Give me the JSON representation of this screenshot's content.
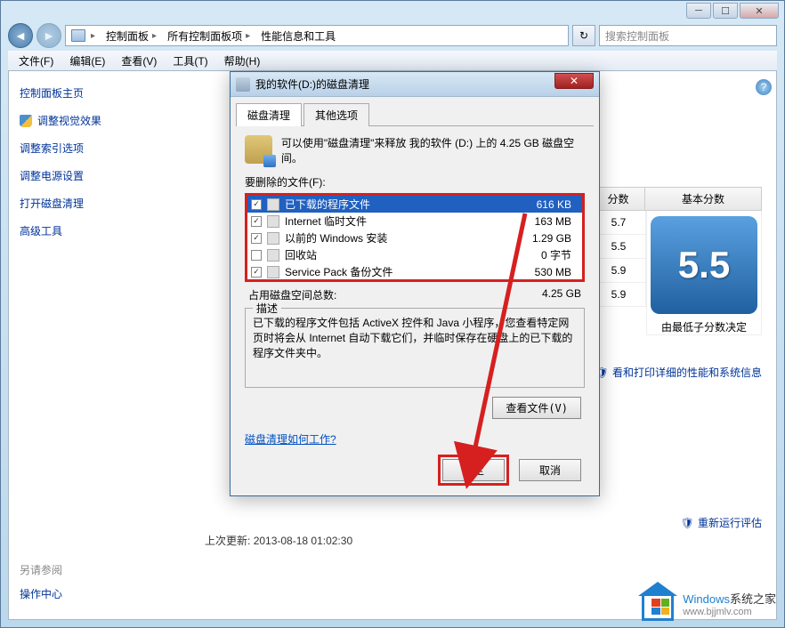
{
  "window": {
    "breadcrumb": [
      "控制面板",
      "所有控制面板项",
      "性能信息和工具"
    ],
    "search_placeholder": "搜索控制面板"
  },
  "menu": [
    "文件(F)",
    "编辑(E)",
    "查看(V)",
    "工具(T)",
    "帮助(H)"
  ],
  "sidebar": {
    "title": "控制面板主页",
    "links": [
      "调整视觉效果",
      "调整索引选项",
      "调整电源设置",
      "打开磁盘清理",
      "高级工具"
    ],
    "footer_heading": "另请参阅",
    "footer_link": "操作中心"
  },
  "main": {
    "score_header_sub": "分数",
    "score_header_base": "基本分数",
    "subscores": [
      "5.7",
      "5.5",
      "5.9",
      "5.9"
    ],
    "base_score": "5.5",
    "base_score_label": "由最低子分数决定",
    "detail_link": "看和打印详细的性能和系统信息",
    "rerun_link": "重新运行评估",
    "last_update_label": "上次更新:",
    "last_update_value": "2013-08-18 01:02:30"
  },
  "dialog": {
    "title": "我的软件(D:)的磁盘清理",
    "tabs": [
      "磁盘清理",
      "其他选项"
    ],
    "info_text": "可以使用\"磁盘清理\"来释放 我的软件 (D:) 上的 4.25 GB 磁盘空间。",
    "files_label": "要删除的文件(F):",
    "files": [
      {
        "name": "已下载的程序文件",
        "size": "616 KB",
        "checked": true,
        "selected": true
      },
      {
        "name": "Internet 临时文件",
        "size": "163 MB",
        "checked": true,
        "selected": false
      },
      {
        "name": "以前的 Windows 安装",
        "size": "1.29 GB",
        "checked": true,
        "selected": false
      },
      {
        "name": "回收站",
        "size": "0 字节",
        "checked": false,
        "selected": false
      },
      {
        "name": "Service Pack 备份文件",
        "size": "530 MB",
        "checked": true,
        "selected": false
      }
    ],
    "total_label": "占用磁盘空间总数:",
    "total_value": "4.25 GB",
    "desc_heading": "描述",
    "desc_text": "已下载的程序文件包括 ActiveX 控件和 Java 小程序，您查看特定网页时将会从 Internet 自动下载它们，并临时保存在硬盘上的已下载的程序文件夹中。",
    "view_files_btn": "查看文件(V)",
    "help_link": "磁盘清理如何工作?",
    "ok_btn": "确定",
    "cancel_btn": "取消"
  },
  "watermark": {
    "line1a": "Windows",
    "line1b": "系统之家",
    "line2": "www.bjjmlv.com"
  }
}
